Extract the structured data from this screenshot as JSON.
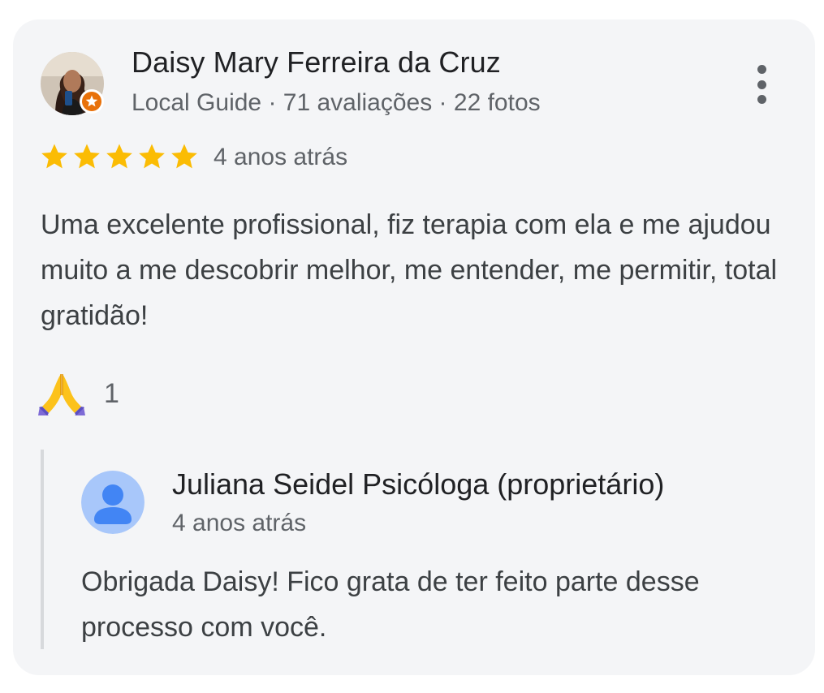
{
  "review": {
    "reviewer_name": "Daisy Mary Ferreira da Cruz",
    "reviewer_meta": "Local Guide · 71 avaliações · 22 fotos",
    "rating": 5,
    "rating_max": 5,
    "date": "4 anos atrás",
    "text": "Uma excelente profissional, fiz terapia com ela e me ajudou muito a me descobrir melhor, me entender, me permitir, total gratidão!",
    "reaction_icon": "folded-hands-icon",
    "reaction_count": "1"
  },
  "owner_reply": {
    "name": "Juliana Seidel Psicóloga (proprietário)",
    "date": "4 anos atrás",
    "text": "Obrigada Daisy! Fico grata de ter feito parte desse processo com você."
  },
  "colors": {
    "card_background": "#f4f5f7",
    "star": "#fbbc04",
    "local_guide_badge": "#e8710a",
    "owner_avatar_bg": "#a8c7fa",
    "owner_avatar_fg": "#4285f4",
    "reply_bar": "#d7d9dc"
  }
}
